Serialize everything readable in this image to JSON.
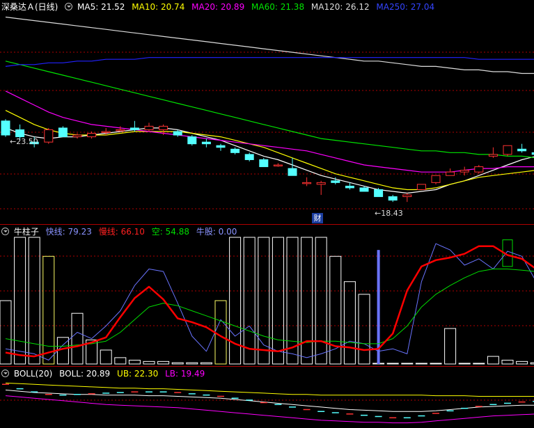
{
  "price_legend": {
    "title": "深桑达Ａ(日线)",
    "ma5": "MA5: 21.52",
    "ma10": "MA10: 20.74",
    "ma20": "MA20: 20.89",
    "ma60": "MA60: 21.38",
    "ma120": "MA120: 26.12",
    "ma250": "MA250: 27.04"
  },
  "price_annotations": {
    "high_label": "23.50",
    "low_label": "18.43",
    "badge": "财"
  },
  "ind_legend": {
    "title": "牛柱子",
    "fast": "快线: 79.23",
    "slow": "慢线: 66.10",
    "empty": "空: 54.88",
    "bull": "牛股: 0.00"
  },
  "boll_legend": {
    "title": "BOLL(20)",
    "boll": "BOLL: 20.89",
    "ub": "UB: 22.30",
    "lb": "LB: 19.49"
  },
  "colors": {
    "up": "#ff3232",
    "down": "#54ffff",
    "ma5": "#ffffff",
    "ma10": "#ffff00",
    "ma20": "#ff00ff",
    "ma60": "#00e600",
    "ma120": "#dddddd",
    "ma250": "#2222ff",
    "fast": "#6a74ff",
    "slow": "#ff0000",
    "kong": "#00dd00",
    "grid": "#b00000"
  },
  "chart_data": [
    {
      "type": "candlestick",
      "ylim": [
        17.8,
        29.5
      ],
      "candles": [
        {
          "o": 23.5,
          "h": 23.6,
          "l": 22.6,
          "c": 22.7
        },
        {
          "o": 23.0,
          "h": 23.3,
          "l": 22.4,
          "c": 22.6
        },
        {
          "o": 22.3,
          "h": 22.6,
          "l": 22.0,
          "c": 22.2
        },
        {
          "o": 22.3,
          "h": 23.1,
          "l": 22.2,
          "c": 23.0
        },
        {
          "o": 23.1,
          "h": 23.2,
          "l": 22.6,
          "c": 22.6
        },
        {
          "o": 22.6,
          "h": 22.8,
          "l": 22.5,
          "c": 22.7
        },
        {
          "o": 22.6,
          "h": 22.9,
          "l": 22.5,
          "c": 22.8
        },
        {
          "o": 22.9,
          "h": 23.1,
          "l": 22.7,
          "c": 22.9
        },
        {
          "o": 23.0,
          "h": 23.2,
          "l": 22.9,
          "c": 23.0
        },
        {
          "o": 23.1,
          "h": 23.5,
          "l": 22.9,
          "c": 23.0
        },
        {
          "o": 23.0,
          "h": 23.4,
          "l": 22.9,
          "c": 23.2
        },
        {
          "o": 23.0,
          "h": 23.3,
          "l": 22.7,
          "c": 23.2
        },
        {
          "o": 22.9,
          "h": 23.0,
          "l": 22.6,
          "c": 22.7
        },
        {
          "o": 22.6,
          "h": 22.7,
          "l": 22.1,
          "c": 22.2
        },
        {
          "o": 22.3,
          "h": 22.5,
          "l": 22.0,
          "c": 22.2
        },
        {
          "o": 22.1,
          "h": 22.2,
          "l": 21.8,
          "c": 22.0
        },
        {
          "o": 21.9,
          "h": 22.0,
          "l": 21.6,
          "c": 21.7
        },
        {
          "o": 21.6,
          "h": 21.7,
          "l": 21.2,
          "c": 21.3
        },
        {
          "o": 21.3,
          "h": 21.4,
          "l": 20.9,
          "c": 20.9
        },
        {
          "o": 21.0,
          "h": 21.1,
          "l": 20.9,
          "c": 21.0
        },
        {
          "o": 20.8,
          "h": 21.4,
          "l": 20.4,
          "c": 20.4
        },
        {
          "o": 20.0,
          "h": 20.3,
          "l": 19.8,
          "c": 20.0
        },
        {
          "o": 19.9,
          "h": 20.1,
          "l": 19.3,
          "c": 20.0
        },
        {
          "o": 20.1,
          "h": 20.3,
          "l": 19.9,
          "c": 20.0
        },
        {
          "o": 19.8,
          "h": 20.0,
          "l": 19.6,
          "c": 19.7
        },
        {
          "o": 19.7,
          "h": 19.8,
          "l": 19.5,
          "c": 19.5
        },
        {
          "o": 19.6,
          "h": 19.7,
          "l": 19.2,
          "c": 19.2
        },
        {
          "o": 19.2,
          "h": 19.3,
          "l": 18.9,
          "c": 19.0
        },
        {
          "o": 19.2,
          "h": 19.4,
          "l": 18.9,
          "c": 19.3
        },
        {
          "o": 19.6,
          "h": 19.9,
          "l": 19.6,
          "c": 19.9
        },
        {
          "o": 20.0,
          "h": 20.4,
          "l": 19.9,
          "c": 20.4
        },
        {
          "o": 20.4,
          "h": 20.8,
          "l": 20.4,
          "c": 20.6
        },
        {
          "o": 20.6,
          "h": 20.9,
          "l": 20.4,
          "c": 20.7
        },
        {
          "o": 20.6,
          "h": 21.0,
          "l": 20.5,
          "c": 20.9
        },
        {
          "o": 21.5,
          "h": 22.0,
          "l": 21.4,
          "c": 21.6
        },
        {
          "o": 21.6,
          "h": 22.1,
          "l": 21.5,
          "c": 22.1
        },
        {
          "o": 21.9,
          "h": 22.2,
          "l": 21.7,
          "c": 21.8
        },
        {
          "o": 21.7,
          "h": 21.9,
          "l": 21.5,
          "c": 21.6
        },
        {
          "o": 21.6,
          "h": 21.7,
          "l": 21.3,
          "c": 21.4
        }
      ],
      "series": [
        {
          "values": [
            23.1,
            22.8,
            22.6,
            22.5,
            22.6,
            22.6,
            22.7,
            22.8,
            22.9,
            23.0,
            23.1,
            23.1,
            23.0,
            22.8,
            22.6,
            22.4,
            22.1,
            21.8,
            21.5,
            21.3,
            21.0,
            20.7,
            20.4,
            20.2,
            20.0,
            19.8,
            19.6,
            19.5,
            19.4,
            19.5,
            19.6,
            19.9,
            20.1,
            20.4,
            20.7,
            21.0,
            21.3,
            21.5,
            21.5
          ]
        },
        {
          "values": [
            24.1,
            23.7,
            23.3,
            23.0,
            22.8,
            22.7,
            22.7,
            22.7,
            22.8,
            22.9,
            22.9,
            22.9,
            22.9,
            22.8,
            22.7,
            22.6,
            22.4,
            22.2,
            22.0,
            21.7,
            21.4,
            21.1,
            20.8,
            20.5,
            20.3,
            20.1,
            19.9,
            19.7,
            19.6,
            19.6,
            19.7,
            19.9,
            20.1,
            20.3,
            20.4,
            20.5,
            20.6,
            20.7,
            20.7
          ]
        },
        {
          "values": [
            25.2,
            24.8,
            24.4,
            24.0,
            23.7,
            23.5,
            23.3,
            23.2,
            23.1,
            23.0,
            22.9,
            22.8,
            22.7,
            22.6,
            22.5,
            22.4,
            22.3,
            22.2,
            22.1,
            22.0,
            21.9,
            21.8,
            21.6,
            21.4,
            21.2,
            21.0,
            20.9,
            20.8,
            20.7,
            20.6,
            20.6,
            20.6,
            20.7,
            20.8,
            20.8,
            20.9,
            20.9,
            20.9,
            20.9
          ]
        },
        {
          "values": [
            26.9,
            26.7,
            26.5,
            26.3,
            26.1,
            25.9,
            25.7,
            25.5,
            25.3,
            25.1,
            24.9,
            24.7,
            24.5,
            24.3,
            24.1,
            23.9,
            23.7,
            23.5,
            23.3,
            23.1,
            22.9,
            22.7,
            22.5,
            22.4,
            22.3,
            22.2,
            22.1,
            22.0,
            21.9,
            21.8,
            21.8,
            21.7,
            21.7,
            21.6,
            21.6,
            21.5,
            21.5,
            21.4,
            21.4
          ]
        },
        {
          "values": [
            29.4,
            29.3,
            29.2,
            29.1,
            29.0,
            28.9,
            28.8,
            28.7,
            28.6,
            28.5,
            28.4,
            28.3,
            28.2,
            28.1,
            28.0,
            27.9,
            27.8,
            27.7,
            27.6,
            27.5,
            27.4,
            27.3,
            27.2,
            27.1,
            27.0,
            26.9,
            26.9,
            26.8,
            26.7,
            26.6,
            26.6,
            26.5,
            26.4,
            26.4,
            26.3,
            26.3,
            26.2,
            26.2,
            26.1
          ]
        },
        {
          "values": [
            26.6,
            26.7,
            26.7,
            26.8,
            26.8,
            26.9,
            26.9,
            27.0,
            27.0,
            27.0,
            27.1,
            27.1,
            27.1,
            27.1,
            27.1,
            27.1,
            27.1,
            27.1,
            27.1,
            27.1,
            27.1,
            27.1,
            27.1,
            27.1,
            27.1,
            27.1,
            27.1,
            27.1,
            27.1,
            27.1,
            27.1,
            27.1,
            27.1,
            27.0,
            27.0,
            27.0,
            27.0,
            27.0,
            27.0
          ]
        }
      ]
    },
    {
      "type": "bar",
      "ylim": [
        0,
        100
      ],
      "bar_values": [
        50,
        100,
        100,
        85,
        21,
        40,
        19,
        11,
        5,
        3,
        2,
        2,
        1,
        1,
        1,
        50,
        100,
        100,
        100,
        100,
        100,
        100,
        100,
        85,
        65,
        55,
        0,
        0,
        0,
        0,
        0,
        28,
        0,
        0,
        6,
        3,
        2,
        1,
        1
      ],
      "highlight": {
        "index": 26,
        "value": 90
      },
      "box": {
        "index": 35,
        "lo": 77,
        "hi": 98
      },
      "series": [
        {
          "values": [
            12,
            10,
            8,
            3,
            15,
            25,
            20,
            30,
            42,
            62,
            75,
            73,
            48,
            22,
            10,
            35,
            22,
            30,
            15,
            10,
            8,
            5,
            8,
            12,
            18,
            16,
            10,
            12,
            8,
            65,
            95,
            90,
            78,
            83,
            75,
            89,
            85,
            65,
            58
          ]
        },
        {
          "values": [
            9,
            7,
            6,
            9,
            12,
            14,
            17,
            21,
            37,
            52,
            61,
            51,
            36,
            33,
            29,
            22,
            16,
            12,
            11,
            10,
            13,
            18,
            18,
            14,
            13,
            11,
            12,
            24,
            58,
            77,
            82,
            84,
            87,
            93,
            93,
            86,
            83,
            75,
            72
          ]
        },
        {
          "values": [
            20,
            18,
            16,
            14,
            14,
            15,
            16,
            18,
            25,
            35,
            45,
            48,
            46,
            42,
            38,
            34,
            30,
            26,
            22,
            19,
            18,
            17,
            18,
            18,
            17,
            16,
            16,
            20,
            30,
            45,
            55,
            62,
            68,
            73,
            75,
            75,
            74,
            73,
            72
          ]
        }
      ]
    },
    {
      "type": "boll",
      "ylim": [
        17.5,
        25.0
      ],
      "ticks": [
        24.2,
        23.5,
        23.0,
        22.6,
        22.5,
        22.6,
        22.7,
        22.8,
        22.9,
        23.0,
        23.0,
        23.0,
        22.9,
        22.7,
        22.5,
        22.3,
        22.0,
        21.7,
        21.3,
        21.0,
        20.6,
        20.2,
        19.9,
        19.7,
        19.5,
        19.3,
        19.1,
        18.9,
        18.9,
        19.2,
        19.6,
        20.0,
        20.4,
        20.7,
        21.0,
        21.2,
        21.4,
        21.5,
        21.5
      ],
      "series": [
        {
          "values": [
            24.4,
            24.3,
            24.2,
            24.1,
            24.0,
            23.9,
            23.8,
            23.7,
            23.6,
            23.6,
            23.5,
            23.5,
            23.4,
            23.3,
            23.2,
            23.1,
            23.0,
            22.9,
            22.8,
            22.7,
            22.6,
            22.6,
            22.5,
            22.5,
            22.5,
            22.5,
            22.5,
            22.5,
            22.5,
            22.5,
            22.4,
            22.4,
            22.4,
            22.3,
            22.3,
            22.3,
            22.3,
            22.3,
            22.3
          ]
        },
        {
          "values": [
            23.3,
            23.1,
            22.9,
            22.8,
            22.7,
            22.6,
            22.6,
            22.5,
            22.5,
            22.5,
            22.4,
            22.4,
            22.3,
            22.2,
            22.1,
            22.0,
            21.8,
            21.6,
            21.4,
            21.2,
            21.0,
            20.8,
            20.6,
            20.4,
            20.2,
            20.1,
            20.0,
            19.9,
            19.9,
            19.9,
            20.0,
            20.2,
            20.4,
            20.6,
            20.7,
            20.8,
            20.9,
            20.9,
            20.9
          ]
        },
        {
          "values": [
            22.4,
            22.2,
            22.0,
            21.8,
            21.6,
            21.4,
            21.2,
            21.0,
            20.9,
            20.8,
            20.7,
            20.6,
            20.5,
            20.3,
            20.1,
            19.9,
            19.7,
            19.5,
            19.3,
            19.1,
            18.9,
            18.7,
            18.5,
            18.4,
            18.3,
            18.2,
            18.2,
            18.1,
            18.1,
            18.2,
            18.4,
            18.6,
            18.8,
            19.0,
            19.2,
            19.3,
            19.4,
            19.5,
            19.5
          ]
        }
      ]
    }
  ]
}
